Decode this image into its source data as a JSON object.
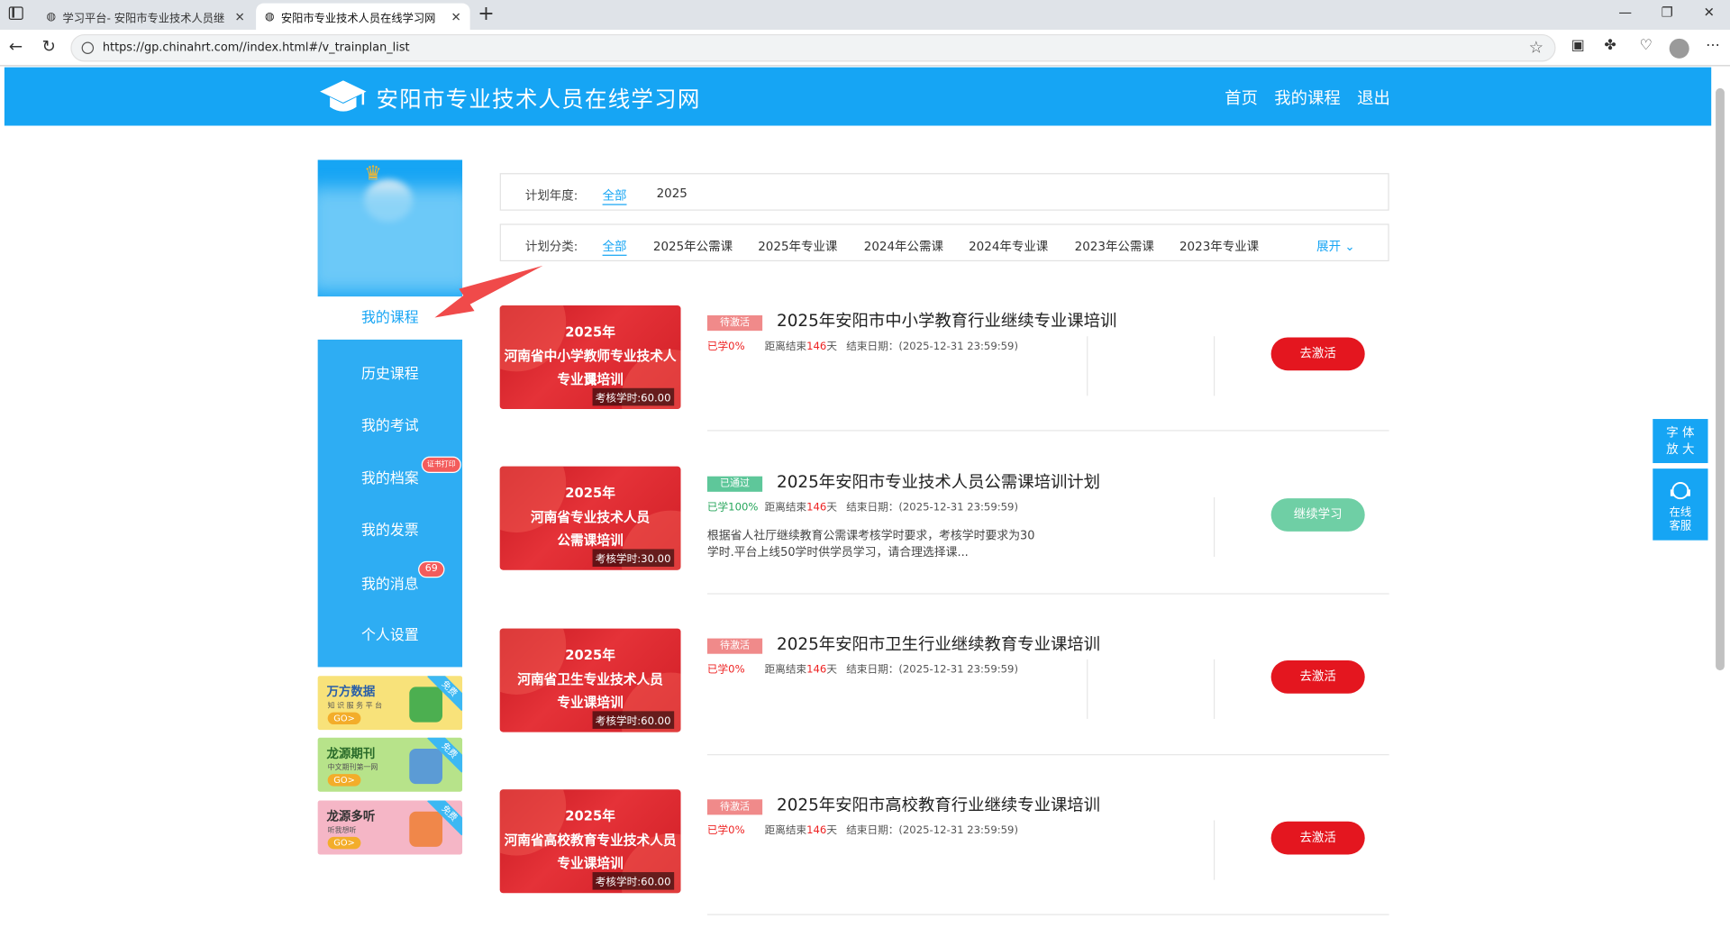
{
  "browser": {
    "tabs": [
      {
        "title": "学习平台- 安阳市专业技术人员继",
        "close": "✕"
      },
      {
        "title": "安阳市专业技术人员在线学习网",
        "close": "✕"
      }
    ],
    "new_tab": "+",
    "url": "https://gp.chinahrt.com//index.html#/v_trainplan_list"
  },
  "header": {
    "site_title": "安阳市专业技术人员在线学习网",
    "nav": [
      "首页",
      "我的课程",
      "退出"
    ]
  },
  "sidebar": {
    "active_item": "我的课程",
    "items": [
      {
        "label": "历史课程"
      },
      {
        "label": "我的考试"
      },
      {
        "label": "我的档案",
        "badge": "证书打印"
      },
      {
        "label": "我的发票"
      },
      {
        "label": "我的消息",
        "badge": "69"
      },
      {
        "label": "个人设置"
      }
    ],
    "ads": [
      {
        "title": "万方数据",
        "subtitle": "知 识 服 务 平 台",
        "go": "GO>",
        "free": "免费",
        "bg": "#f8e27a",
        "pic": "#4caf50"
      },
      {
        "title": "龙源期刊",
        "subtitle": "中文期刊第一网",
        "go": "GO>",
        "free": "免费",
        "bg": "#b7e38a",
        "pic": "#5b9bd5"
      },
      {
        "title": "龙源多听",
        "subtitle": "听我想听",
        "go": "GO>",
        "free": "免费",
        "bg": "#f5b6c6",
        "pic": "#f0874a"
      }
    ]
  },
  "filters": {
    "year_label": "计划年度:",
    "years": [
      "全部",
      "2025"
    ],
    "category_label": "计划分类:",
    "categories": [
      "全部",
      "2025年公需课",
      "2025年专业课",
      "2024年公需课",
      "2024年专业课",
      "2023年公需课",
      "2023年专业课"
    ],
    "expand": "展开"
  },
  "courses": [
    {
      "thumb_lines": [
        "2025年",
        "河南省中小学教师专业技术人员",
        "专业课培训"
      ],
      "hours": "考核学时:60.00",
      "status": "待激活",
      "title": "2025年安阳市中小学教育行业继续专业课培训",
      "progress": "已学0%",
      "countdown_prefix": "距离结束",
      "days": "146",
      "countdown_suffix": "天",
      "end_date": "结束日期：(2025-12-31 23:59:59)",
      "desc": "",
      "button": "去激活"
    },
    {
      "thumb_lines": [
        "2025年",
        "河南省专业技术人员",
        "公需课培训"
      ],
      "hours": "考核学时:30.00",
      "status": "已通过",
      "title": "2025年安阳市专业技术人员公需课培训计划",
      "progress": "已学100%",
      "countdown_prefix": "距离结束",
      "days": "146",
      "countdown_suffix": "天",
      "end_date": "结束日期：(2025-12-31 23:59:59)",
      "desc": "根据省人社厅继续教育公需课考核学时要求，考核学时要求为30学时.平台上线50学时供学员学习，请合理选择课...",
      "button": "继续学习"
    },
    {
      "thumb_lines": [
        "2025年",
        "河南省卫生专业技术人员",
        "专业课培训"
      ],
      "hours": "考核学时:60.00",
      "status": "待激活",
      "title": "2025年安阳市卫生行业继续教育专业课培训",
      "progress": "已学0%",
      "countdown_prefix": "距离结束",
      "days": "146",
      "countdown_suffix": "天",
      "end_date": "结束日期：(2025-12-31 23:59:59)",
      "desc": "",
      "button": "去激活"
    },
    {
      "thumb_lines": [
        "2025年",
        "河南省高校教育专业技术人员",
        "专业课培训"
      ],
      "hours": "考核学时:60.00",
      "status": "待激活",
      "title": "2025年安阳市高校教育行业继续专业课培训",
      "progress": "已学0%",
      "countdown_prefix": "距离结束",
      "days": "146",
      "countdown_suffix": "天",
      "end_date": "结束日期：(2025-12-31 23:59:59)",
      "desc": "",
      "button": "去激活"
    }
  ],
  "float": {
    "font_btn": "字 体\n放 大",
    "service_btn": "在线\n客服"
  },
  "colors": {
    "primary": "#16a5f4",
    "status_pending": "#f08a8a",
    "status_passed": "#5ec79a",
    "btn_activate": "#e4161f",
    "btn_continue": "#6fcfa5",
    "text_red": "#e22222"
  }
}
